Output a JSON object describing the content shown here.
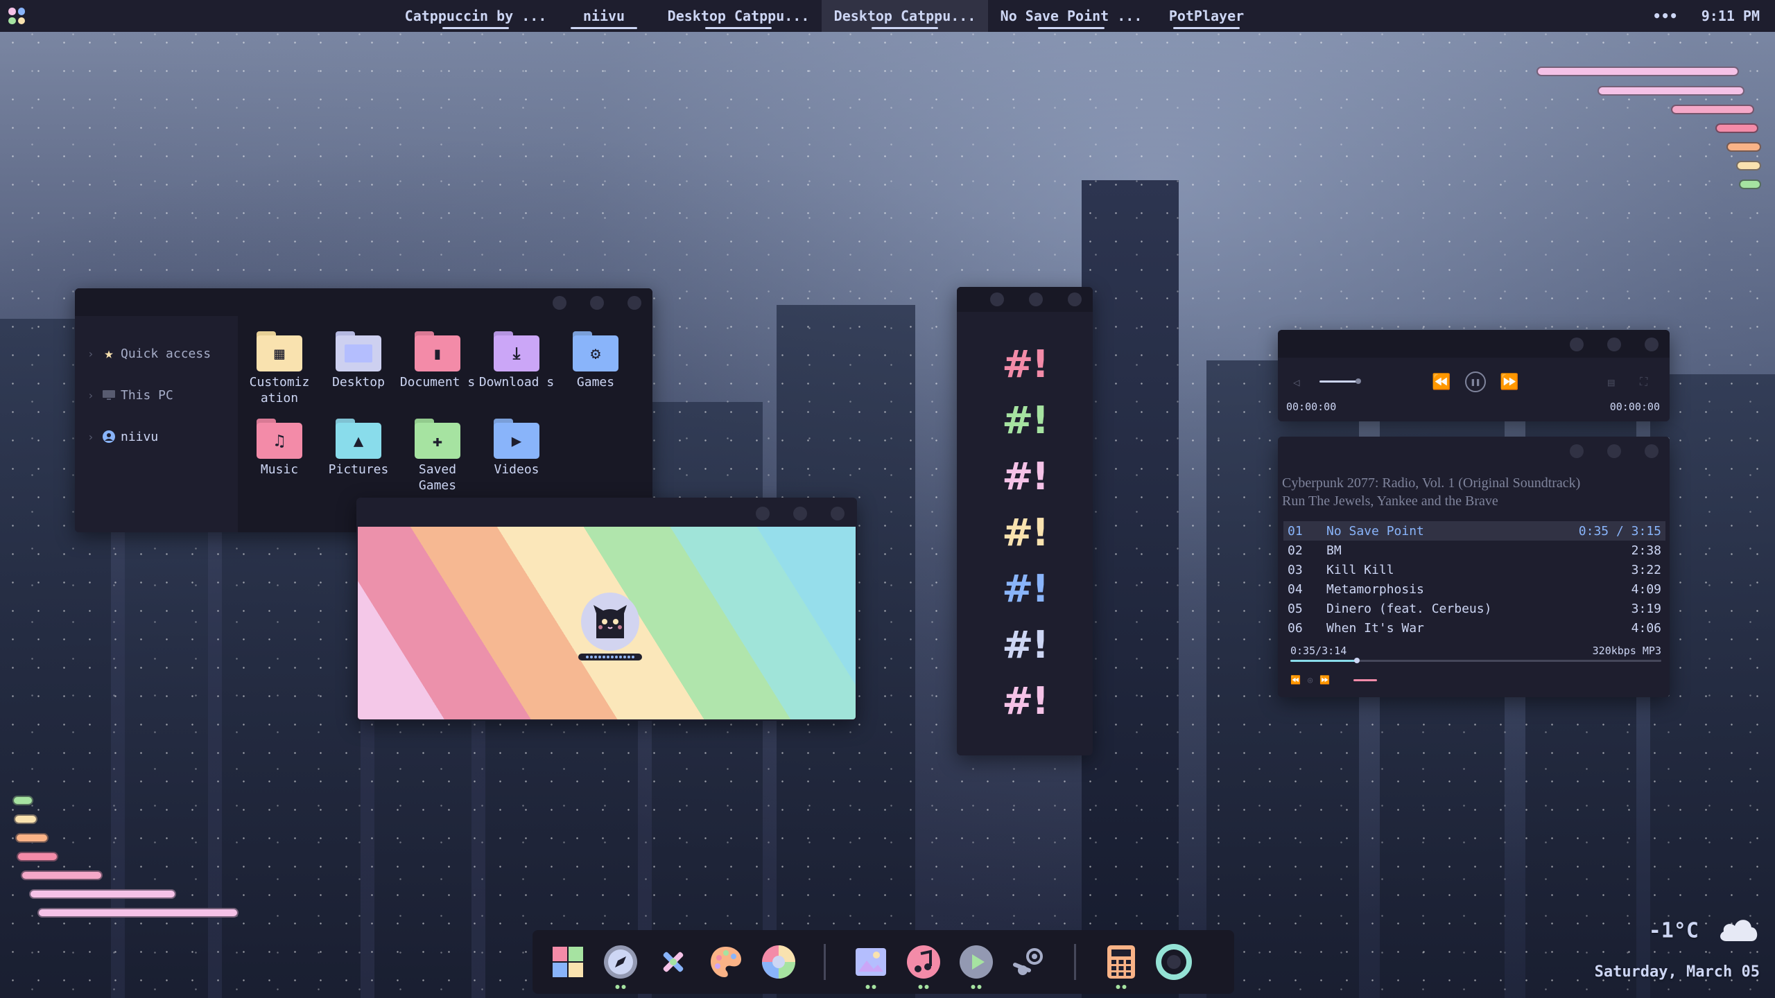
{
  "colors": {
    "base": "#1e1e2e",
    "mantle": "#181825",
    "surface": "#313244",
    "text": "#cdd6f4",
    "pink": "#f5c2e7",
    "red": "#f38ba8",
    "peach": "#fab387",
    "yellow": "#f9e2af",
    "green": "#a6e3a1",
    "teal": "#94e2d5",
    "sky": "#89dceb",
    "blue": "#89b4fa",
    "mauve": "#cba6f7"
  },
  "topbar": {
    "menu_icon": "apps-grid-icon",
    "tasks": [
      {
        "label": "Catppuccin by ...",
        "active": false
      },
      {
        "label": "niivu",
        "active": false
      },
      {
        "label": "Desktop Catppu...",
        "active": false
      },
      {
        "label": "Desktop Catppu...",
        "active": true
      },
      {
        "label": "No Save Point ...",
        "active": false
      },
      {
        "label": "PotPlayer",
        "active": false
      }
    ],
    "overflow": "•••",
    "clock": "9:11 PM"
  },
  "explorer": {
    "sidebar": [
      {
        "label": "Quick access",
        "icon": "star-icon"
      },
      {
        "label": "This PC",
        "icon": "monitor-icon"
      },
      {
        "label": "niivu",
        "icon": "user-icon"
      }
    ],
    "folders": [
      {
        "label": "Customiz ation",
        "icon": "customization-folder-icon"
      },
      {
        "label": "Desktop",
        "icon": "desktop-folder-icon"
      },
      {
        "label": "Document s",
        "icon": "documents-folder-icon"
      },
      {
        "label": "Download s",
        "icon": "downloads-folder-icon"
      },
      {
        "label": "Games",
        "icon": "games-folder-icon"
      },
      {
        "label": "Music",
        "icon": "music-folder-icon"
      },
      {
        "label": "Pictures",
        "icon": "pictures-folder-icon"
      },
      {
        "label": "Saved Games",
        "icon": "saved-games-folder-icon"
      },
      {
        "label": "Videos",
        "icon": "videos-folder-icon"
      }
    ]
  },
  "lockscreen": {
    "avatar_icon": "cat-avatar-icon"
  },
  "hashbang": {
    "glyph": "#!",
    "colors": [
      "#f38ba8",
      "#a6e3a1",
      "#f5c2e7",
      "#f9e2af",
      "#89b4fa",
      "#cdd6f4",
      "#f5c2e7"
    ]
  },
  "player": {
    "time_left": "00:00:00",
    "time_right": "00:00:00"
  },
  "playlist": {
    "album": "Cyberpunk 2077: Radio, Vol. 1 (Original Soundtrack)",
    "artist": "Run The Jewels, Yankee and the Brave",
    "tracks": [
      {
        "num": "01",
        "title": "No Save Point",
        "duration": "0:35 / 3:15",
        "active": true
      },
      {
        "num": "02",
        "title": "BM",
        "duration": "2:38",
        "active": false
      },
      {
        "num": "03",
        "title": "Kill Kill",
        "duration": "3:22",
        "active": false
      },
      {
        "num": "04",
        "title": "Metamorphosis",
        "duration": "4:09",
        "active": false
      },
      {
        "num": "05",
        "title": "Dinero (feat. Cerbeus)",
        "duration": "3:19",
        "active": false
      },
      {
        "num": "06",
        "title": "When It's War",
        "duration": "4:06",
        "active": false
      }
    ],
    "position": "0:35/3:14",
    "format": "320kbps MP3",
    "progress": 0.18
  },
  "dock": {
    "items": [
      {
        "name": "start-icon",
        "running": false
      },
      {
        "name": "browser-icon",
        "running": true
      },
      {
        "name": "tools-icon",
        "running": false
      },
      {
        "name": "palette-icon",
        "running": false
      },
      {
        "name": "color-wheel-icon",
        "running": false
      },
      {
        "name": "image-viewer-icon",
        "running": true
      },
      {
        "name": "music-icon",
        "running": true
      },
      {
        "name": "media-player-icon",
        "running": true
      },
      {
        "name": "steam-icon",
        "running": false
      },
      {
        "name": "calculator-icon",
        "running": true
      },
      {
        "name": "ring-app-icon",
        "running": false
      }
    ]
  },
  "weather": {
    "temp": "-1°C",
    "icon": "cloud-icon"
  },
  "date": "Saturday, March 05"
}
